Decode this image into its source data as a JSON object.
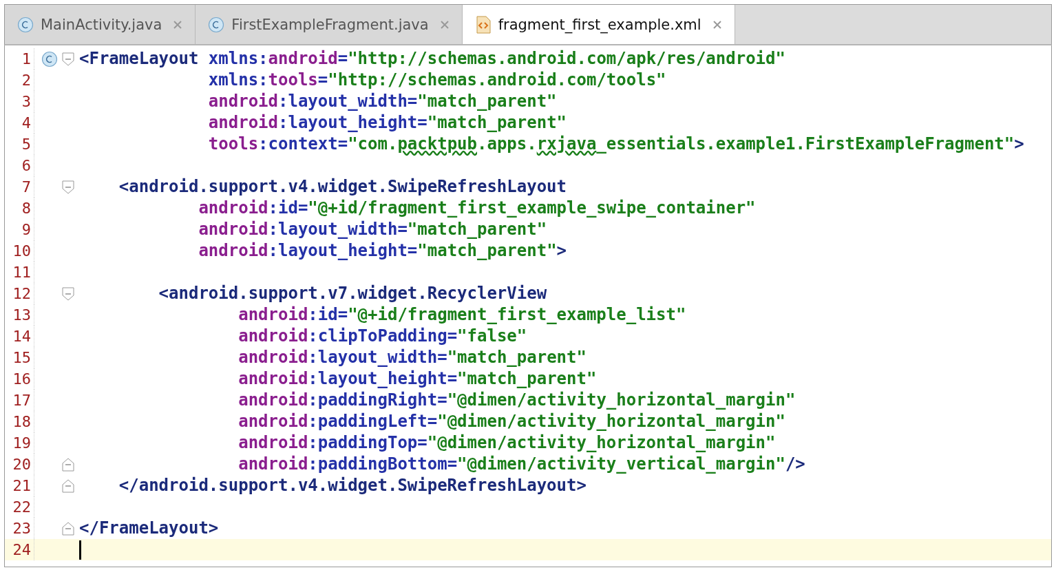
{
  "tabs": [
    {
      "label": "MainActivity.java",
      "kind": "class",
      "selected": false
    },
    {
      "label": "FirstExampleFragment.java",
      "kind": "class",
      "selected": false
    },
    {
      "label": "fragment_first_example.xml",
      "kind": "xml",
      "selected": true
    }
  ],
  "editor": {
    "lines": [
      {
        "number": "1",
        "class_marker": true,
        "fold_start": true,
        "current": false,
        "tokens": [
          {
            "kind": "tag",
            "text": "<FrameLayout "
          },
          {
            "kind": "attr",
            "text": "xmlns:"
          },
          {
            "kind": "ns",
            "text": "android"
          },
          {
            "kind": "attr",
            "text": "="
          },
          {
            "kind": "value",
            "text": "\"http://schemas.android.com/apk/res/android\""
          }
        ]
      },
      {
        "number": "2",
        "current": false,
        "tokens": [
          {
            "kind": "attr",
            "text": "             xmlns:"
          },
          {
            "kind": "ns",
            "text": "tools"
          },
          {
            "kind": "attr",
            "text": "="
          },
          {
            "kind": "value",
            "text": "\"http://schemas.android.com/tools\""
          }
        ]
      },
      {
        "number": "3",
        "current": false,
        "tokens": [
          {
            "kind": "ns",
            "text": "             android"
          },
          {
            "kind": "attr",
            "text": ":layout_width="
          },
          {
            "kind": "value",
            "text": "\"match_parent\""
          }
        ]
      },
      {
        "number": "4",
        "current": false,
        "tokens": [
          {
            "kind": "ns",
            "text": "             android"
          },
          {
            "kind": "attr",
            "text": ":layout_height="
          },
          {
            "kind": "value",
            "text": "\"match_parent\""
          }
        ]
      },
      {
        "number": "5",
        "current": false,
        "tokens": [
          {
            "kind": "ns",
            "text": "             tools"
          },
          {
            "kind": "attr",
            "text": ":context="
          },
          {
            "kind": "value",
            "text": "\"com."
          },
          {
            "kind": "typo",
            "text": "packtpub"
          },
          {
            "kind": "value",
            "text": ".apps."
          },
          {
            "kind": "typo",
            "text": "rxjava"
          },
          {
            "kind": "value",
            "text": "_essentials.example1.FirstExampleFragment\""
          },
          {
            "kind": "tag",
            "text": ">"
          }
        ]
      },
      {
        "number": "6",
        "current": false
      },
      {
        "number": "7",
        "fold_start": true,
        "current": false,
        "tokens": [
          {
            "kind": "tag",
            "text": "    <android.support.v4.widget.SwipeRefreshLayout"
          }
        ]
      },
      {
        "number": "8",
        "current": false,
        "tokens": [
          {
            "kind": "ns",
            "text": "            android"
          },
          {
            "kind": "attr",
            "text": ":id="
          },
          {
            "kind": "value",
            "text": "\"@+id/fragment_first_example_swipe_container\""
          }
        ]
      },
      {
        "number": "9",
        "current": false,
        "tokens": [
          {
            "kind": "ns",
            "text": "            android"
          },
          {
            "kind": "attr",
            "text": ":layout_width="
          },
          {
            "kind": "value",
            "text": "\"match_parent\""
          }
        ]
      },
      {
        "number": "10",
        "current": false,
        "tokens": [
          {
            "kind": "ns",
            "text": "            android"
          },
          {
            "kind": "attr",
            "text": ":layout_height="
          },
          {
            "kind": "value",
            "text": "\"match_parent\""
          },
          {
            "kind": "tag",
            "text": ">"
          }
        ]
      },
      {
        "number": "11",
        "current": false
      },
      {
        "number": "12",
        "fold_start": true,
        "current": false,
        "tokens": [
          {
            "kind": "tag",
            "text": "        <android.support.v7.widget.RecyclerView"
          }
        ]
      },
      {
        "number": "13",
        "current": false,
        "tokens": [
          {
            "kind": "ns",
            "text": "                android"
          },
          {
            "kind": "attr",
            "text": ":id="
          },
          {
            "kind": "value",
            "text": "\"@+id/fragment_first_example_list\""
          }
        ]
      },
      {
        "number": "14",
        "current": false,
        "tokens": [
          {
            "kind": "ns",
            "text": "                android"
          },
          {
            "kind": "attr",
            "text": ":clipToPadding="
          },
          {
            "kind": "value",
            "text": "\"false\""
          }
        ]
      },
      {
        "number": "15",
        "current": false,
        "tokens": [
          {
            "kind": "ns",
            "text": "                android"
          },
          {
            "kind": "attr",
            "text": ":layout_width="
          },
          {
            "kind": "value",
            "text": "\"match_parent\""
          }
        ]
      },
      {
        "number": "16",
        "current": false,
        "tokens": [
          {
            "kind": "ns",
            "text": "                android"
          },
          {
            "kind": "attr",
            "text": ":layout_height="
          },
          {
            "kind": "value",
            "text": "\"match_parent\""
          }
        ]
      },
      {
        "number": "17",
        "current": false,
        "tokens": [
          {
            "kind": "ns",
            "text": "                android"
          },
          {
            "kind": "attr",
            "text": ":paddingRight="
          },
          {
            "kind": "value",
            "text": "\"@dimen/activity_horizontal_margin\""
          }
        ]
      },
      {
        "number": "18",
        "current": false,
        "tokens": [
          {
            "kind": "ns",
            "text": "                android"
          },
          {
            "kind": "attr",
            "text": ":paddingLeft="
          },
          {
            "kind": "value",
            "text": "\"@dimen/activity_horizontal_margin\""
          }
        ]
      },
      {
        "number": "19",
        "current": false,
        "tokens": [
          {
            "kind": "ns",
            "text": "                android"
          },
          {
            "kind": "attr",
            "text": ":paddingTop="
          },
          {
            "kind": "value",
            "text": "\"@dimen/activity_horizontal_margin\""
          }
        ]
      },
      {
        "number": "20",
        "fold_end": true,
        "current": false,
        "tokens": [
          {
            "kind": "ns",
            "text": "                android"
          },
          {
            "kind": "attr",
            "text": ":paddingBottom="
          },
          {
            "kind": "value",
            "text": "\"@dimen/activity_vertical_margin\""
          },
          {
            "kind": "tag",
            "text": "/>"
          }
        ]
      },
      {
        "number": "21",
        "fold_end": true,
        "current": false,
        "tokens": [
          {
            "kind": "tag",
            "text": "    </android.support.v4.widget.SwipeRefreshLayout>"
          }
        ]
      },
      {
        "number": "22",
        "current": false
      },
      {
        "number": "23",
        "fold_end": true,
        "current": false,
        "tokens": [
          {
            "kind": "tag",
            "text": "</FrameLayout>"
          }
        ]
      },
      {
        "number": "24",
        "current": true
      }
    ]
  }
}
